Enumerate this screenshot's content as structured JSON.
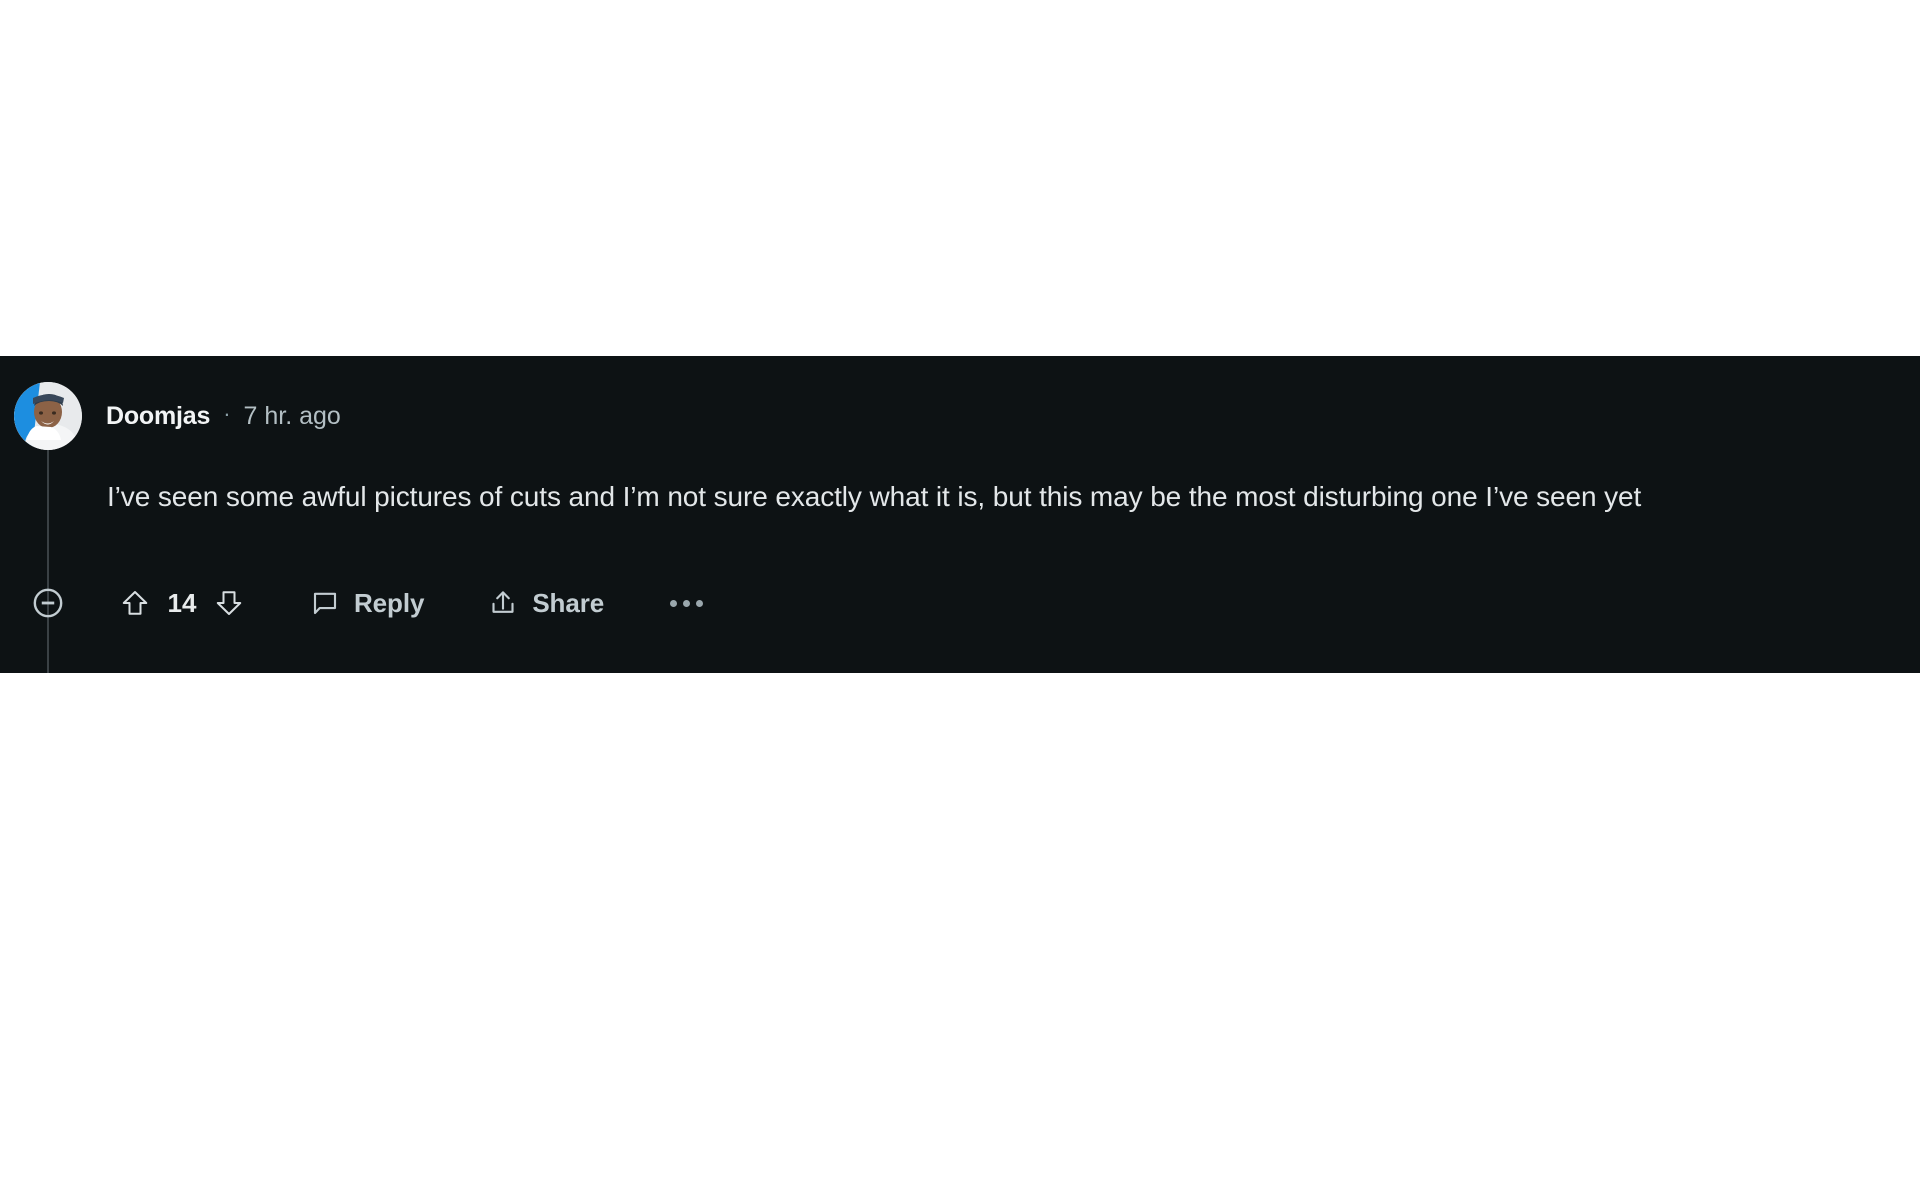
{
  "theme": {
    "page_background": "#ffffff",
    "panel_background": "#0d1214",
    "primary_text": "#e3e7e9",
    "muted_text": "#b3bfc4",
    "icon_color": "#c2ccd1",
    "thread_line": "#3a4145",
    "avatar_accent": "#1d8ee0"
  },
  "comment": {
    "author": "Doomjas",
    "separator": "·",
    "timestamp": "7 hr. ago",
    "body": "I’ve seen some awful pictures of cuts and I’m not sure exactly what it is, but this may be the most disturbing one I’ve seen yet",
    "avatar_alt": "user-avatar-photo"
  },
  "actions": {
    "collapse_icon": "minus-circle-icon",
    "upvote_icon": "upvote-arrow-icon",
    "downvote_icon": "downvote-arrow-icon",
    "vote_count": "14",
    "reply_icon": "comment-bubble-icon",
    "reply_label": "Reply",
    "share_icon": "share-arrow-icon",
    "share_label": "Share",
    "more_icon": "ellipsis-icon"
  }
}
